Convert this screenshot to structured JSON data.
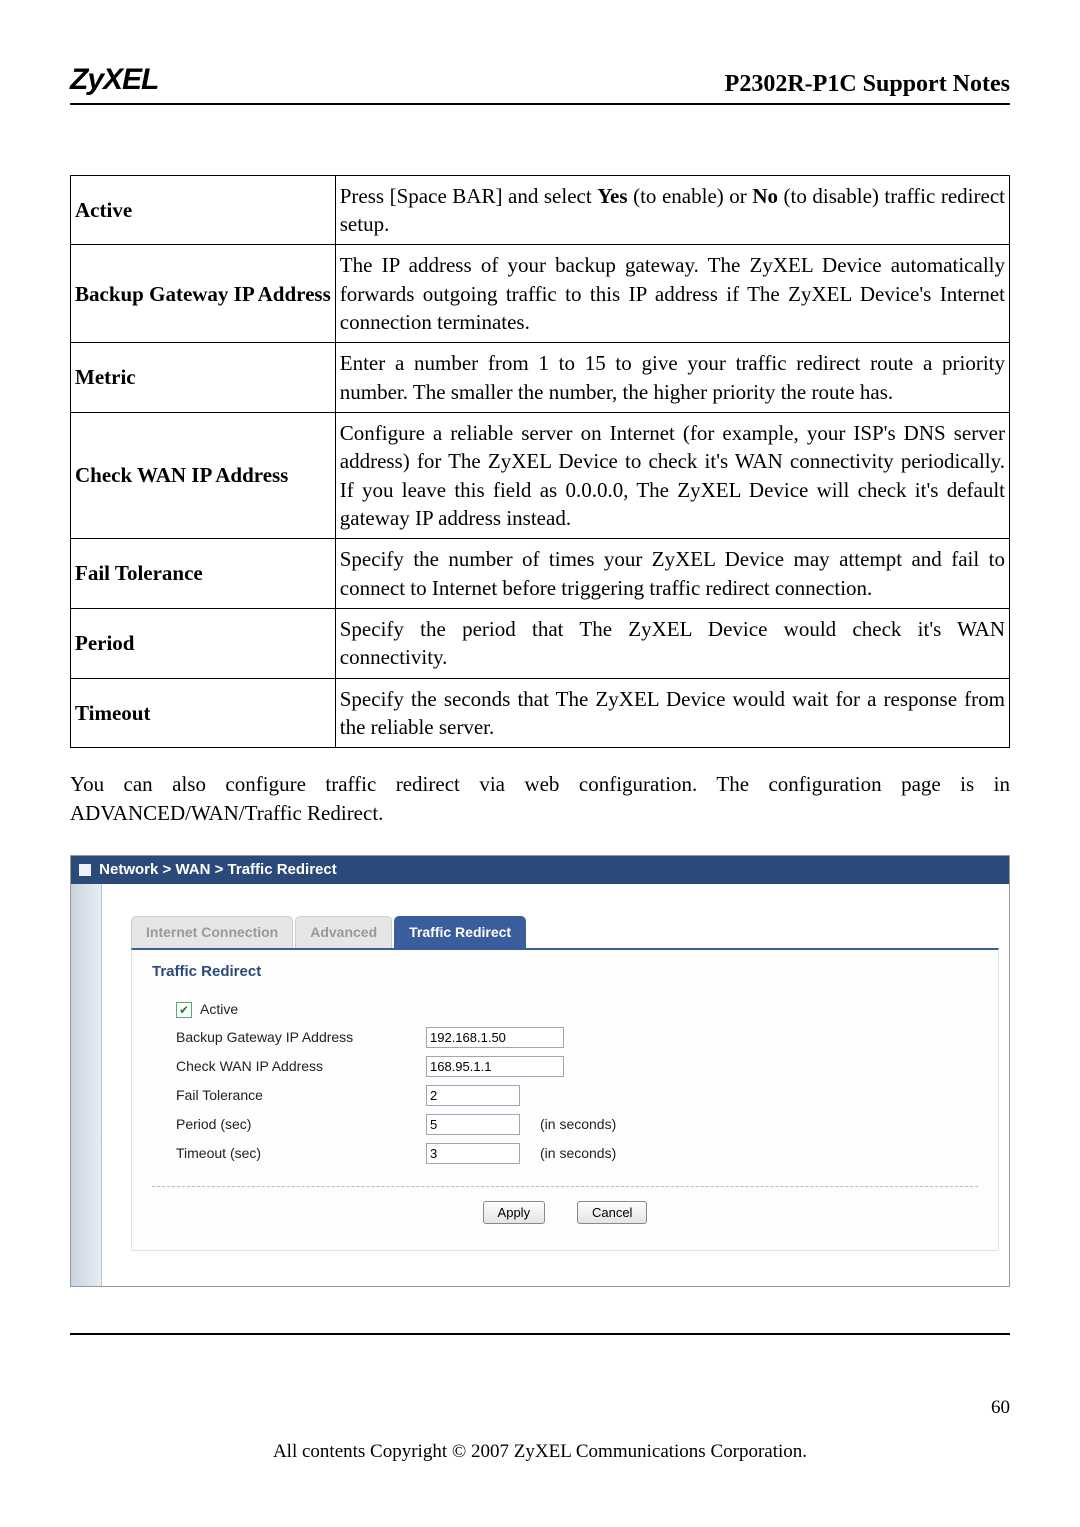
{
  "header": {
    "logo": "ZyXEL",
    "title": "P2302R-P1C Support Notes"
  },
  "table": {
    "rows": [
      {
        "label": "Active",
        "desc_parts": [
          "Press [Space BAR] and select ",
          "Yes",
          " (to enable) or ",
          "No",
          " (to disable) traffic redirect setup."
        ]
      },
      {
        "label": "Backup Gateway IP Address",
        "desc": "The IP address of your backup gateway. The ZyXEL Device automatically forwards outgoing traffic to this IP address if The ZyXEL Device's Internet connection terminates."
      },
      {
        "label": "Metric",
        "desc": "Enter a number from 1 to 15 to give your traffic redirect route a priority number. The smaller the number, the higher priority the route has."
      },
      {
        "label": "Check WAN IP Address",
        "desc": "Configure a reliable server on Internet (for example, your ISP's DNS server address) for The ZyXEL Device to check it's WAN connectivity periodically. If you leave this field as 0.0.0.0, The ZyXEL Device will check it's default gateway IP address instead."
      },
      {
        "label": "Fail Tolerance",
        "desc": "Specify the number of times your ZyXEL Device may attempt and fail to connect to Internet before triggering traffic redirect connection."
      },
      {
        "label": "Period",
        "desc": "Specify the period that The ZyXEL Device would check it's WAN connectivity."
      },
      {
        "label": "Timeout",
        "desc": "Specify the seconds that The ZyXEL Device would wait for a response from the reliable server."
      }
    ]
  },
  "paragraph": {
    "line1": "You can also configure traffic redirect via web configuration. The configuration page is in",
    "line2": "ADVANCED/WAN/Traffic Redirect."
  },
  "screenshot": {
    "breadcrumb": "Network > WAN > Traffic Redirect",
    "tabs": {
      "t1": "Internet Connection",
      "t2": "Advanced",
      "t3": "Traffic Redirect"
    },
    "section_title": "Traffic Redirect",
    "form": {
      "active_label": "Active",
      "backup_label": "Backup Gateway IP Address",
      "backup_value": "192.168.1.50",
      "check_label": "Check WAN IP Address",
      "check_value": "168.95.1.1",
      "fail_label": "Fail Tolerance",
      "fail_value": "2",
      "period_label": "Period (sec)",
      "period_value": "5",
      "period_suffix": "(in seconds)",
      "timeout_label": "Timeout (sec)",
      "timeout_value": "3",
      "timeout_suffix": "(in seconds)"
    },
    "buttons": {
      "apply": "Apply",
      "cancel": "Cancel"
    }
  },
  "footer": {
    "page": "60",
    "copyright": "All contents Copyright © 2007 ZyXEL Communications Corporation."
  }
}
